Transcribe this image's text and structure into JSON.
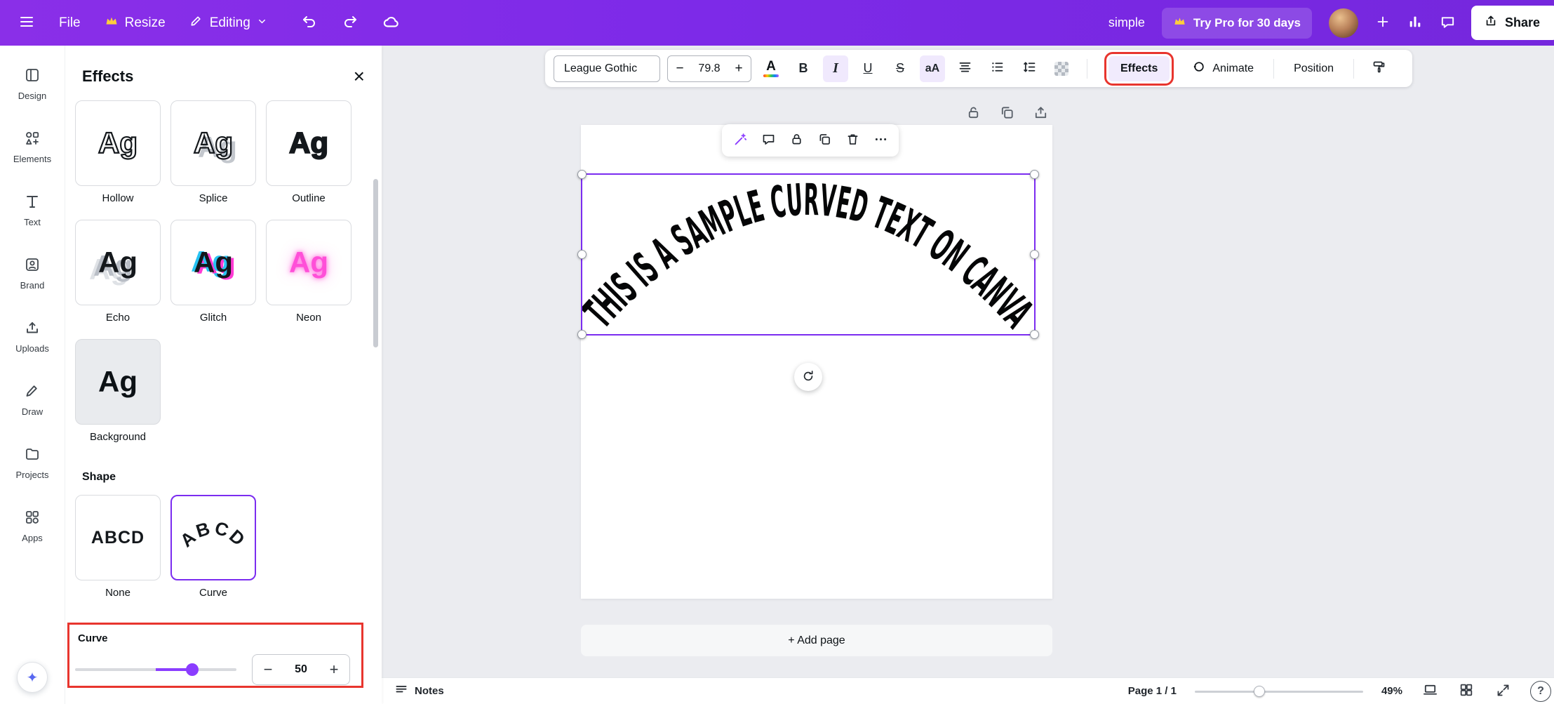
{
  "topbar": {
    "file_label": "File",
    "resize_label": "Resize",
    "editing_label": "Editing",
    "doc_title": "simple",
    "try_pro_label": "Try Pro for 30 days",
    "share_label": "Share"
  },
  "sidebar": {
    "items": [
      {
        "label": "Design"
      },
      {
        "label": "Elements"
      },
      {
        "label": "Text"
      },
      {
        "label": "Brand"
      },
      {
        "label": "Uploads"
      },
      {
        "label": "Draw"
      },
      {
        "label": "Projects"
      },
      {
        "label": "Apps"
      }
    ]
  },
  "effects_panel": {
    "title": "Effects",
    "sample_text": "Ag",
    "style_cards": [
      {
        "label": "Hollow"
      },
      {
        "label": "Splice"
      },
      {
        "label": "Outline"
      },
      {
        "label": "Echo"
      },
      {
        "label": "Glitch"
      },
      {
        "label": "Neon"
      },
      {
        "label": "Background"
      }
    ],
    "shape_section": {
      "title": "Shape",
      "sample_text": "ABCD",
      "cards": [
        {
          "label": "None"
        },
        {
          "label": "Curve"
        }
      ],
      "selected": "Curve"
    },
    "curve_control": {
      "label": "Curve",
      "value": "50"
    }
  },
  "toolbar": {
    "font_name": "League Gothic",
    "font_size": "79.8",
    "color_label": "A",
    "bold_label": "B",
    "italic_label": "I",
    "underline_label": "U",
    "strikethrough_label": "S",
    "case_label": "aA",
    "effects_label": "Effects",
    "animate_label": "Animate",
    "position_label": "Position"
  },
  "canvas": {
    "curved_text": "THIS IS A SAMPLE CURVED TEXT ON CANVA",
    "add_page_label": "+ Add page"
  },
  "statusbar": {
    "notes_label": "Notes",
    "page_indicator": "Page 1 / 1",
    "zoom_percent": "49%"
  },
  "ui": {
    "minus": "−",
    "plus": "+",
    "close": "×",
    "sparkle": "✦",
    "help": "?"
  },
  "colors": {
    "topbar_purple": "#7d2ae8",
    "accent_purple": "#8b3dff",
    "selection_purple": "#7b2cf0",
    "annotation_red": "#e8352e",
    "neon_pink": "#ff4fd8"
  }
}
